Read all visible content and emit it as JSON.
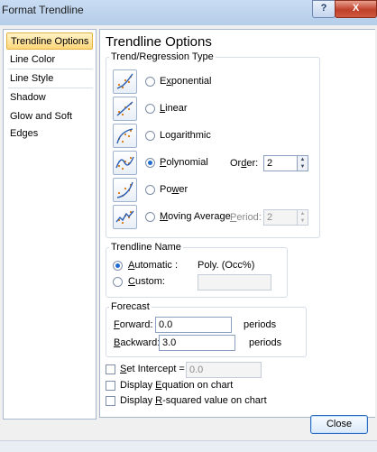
{
  "window": {
    "title": "Format Trendline",
    "help": "?",
    "close": "X"
  },
  "sidebar": {
    "items": [
      {
        "label": "Trendline Options"
      },
      {
        "label": "Line Color"
      },
      {
        "label": "Line Style"
      },
      {
        "label": "Shadow"
      },
      {
        "label": "Glow and Soft Edges"
      }
    ]
  },
  "main": {
    "heading": "Trendline Options",
    "type_group": {
      "legend": "Trend/Regression Type",
      "options": [
        {
          "icon": "exponential-trend-icon",
          "first": "E",
          "u": "x",
          "rest": "ponential",
          "selected": false
        },
        {
          "icon": "linear-trend-icon",
          "first": "",
          "u": "L",
          "rest": "inear",
          "selected": false
        },
        {
          "icon": "logarithmic-trend-icon",
          "first": "Lo",
          "u": "g",
          "rest": "arithmic",
          "selected": false
        },
        {
          "icon": "polynomial-trend-icon",
          "first": "",
          "u": "P",
          "rest": "olynomial",
          "selected": true
        },
        {
          "icon": "power-trend-icon",
          "first": "Po",
          "u": "w",
          "rest": "er",
          "selected": false
        },
        {
          "icon": "moving-average-trend-icon",
          "first": "",
          "u": "M",
          "rest": "oving Average",
          "selected": false
        }
      ],
      "order": {
        "first": "Or",
        "u": "d",
        "rest": "er:",
        "value": "2"
      },
      "period": {
        "first": "",
        "u": "P",
        "rest": "eriod:",
        "value": "2"
      }
    },
    "name_group": {
      "legend": "Trendline Name",
      "automatic": {
        "first": "",
        "u": "A",
        "rest": "utomatic :",
        "value": "Poly. (Occ%)",
        "selected": true
      },
      "custom": {
        "first": "",
        "u": "C",
        "rest": "ustom:",
        "value": "",
        "selected": false
      }
    },
    "forecast": {
      "legend": "Forecast",
      "forward": {
        "first": "",
        "u": "F",
        "rest": "orward:",
        "value": "0.0",
        "unit": "periods"
      },
      "backward": {
        "first": "",
        "u": "B",
        "rest": "ackward:",
        "value": "3.0",
        "unit": "periods"
      }
    },
    "checks": {
      "intercept": {
        "first": "",
        "u": "S",
        "rest": "et Intercept =",
        "value": "0.0"
      },
      "equation": {
        "first": "Display ",
        "u": "E",
        "rest": "quation on chart"
      },
      "rsquared": {
        "first": "Display ",
        "u": "R",
        "rest": "-squared value on chart"
      }
    }
  },
  "footer": {
    "close_label": "Close"
  }
}
